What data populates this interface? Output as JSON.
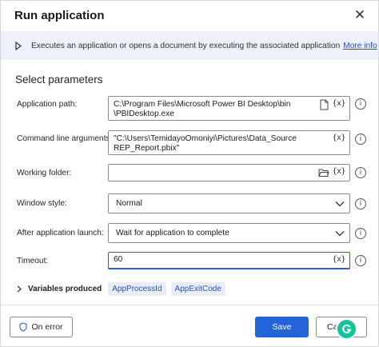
{
  "dialog": {
    "title": "Run application",
    "close_icon": "close-icon"
  },
  "info": {
    "description": "Executes an application or opens a document by executing the associated application",
    "more_info": "More info"
  },
  "section": {
    "title": "Select parameters"
  },
  "fields": {
    "app_path": {
      "label": "Application path:",
      "value": "C:\\Program Files\\Microsoft Power BI Desktop\\bin\n\\PBIDesktop.exe",
      "var": "{x}"
    },
    "cmd_args": {
      "label": "Command line arguments:",
      "value": "\"C:\\Users\\TemidayoOmoniyi\\Pictures\\Data_Source\nREP_Report.pbix\"",
      "var": "{x}"
    },
    "working_folder": {
      "label": "Working folder:",
      "value": "",
      "var": "{x}"
    },
    "window_style": {
      "label": "Window style:",
      "value": "Normal"
    },
    "after_launch": {
      "label": "After application launch:",
      "value": "Wait for application to complete"
    },
    "timeout": {
      "label": "Timeout:",
      "value": "60",
      "var": "{x}"
    }
  },
  "variables": {
    "label": "Variables produced",
    "items": [
      "AppProcessId",
      "AppExitCode"
    ]
  },
  "footer": {
    "on_error": "On error",
    "save": "Save",
    "cancel": "Ca"
  },
  "help_glyph": "i",
  "colors": {
    "accent": "#2563d8",
    "info_bar": "#eef0fa",
    "link": "#2a4ec4",
    "grammarly": "#15c39a"
  }
}
